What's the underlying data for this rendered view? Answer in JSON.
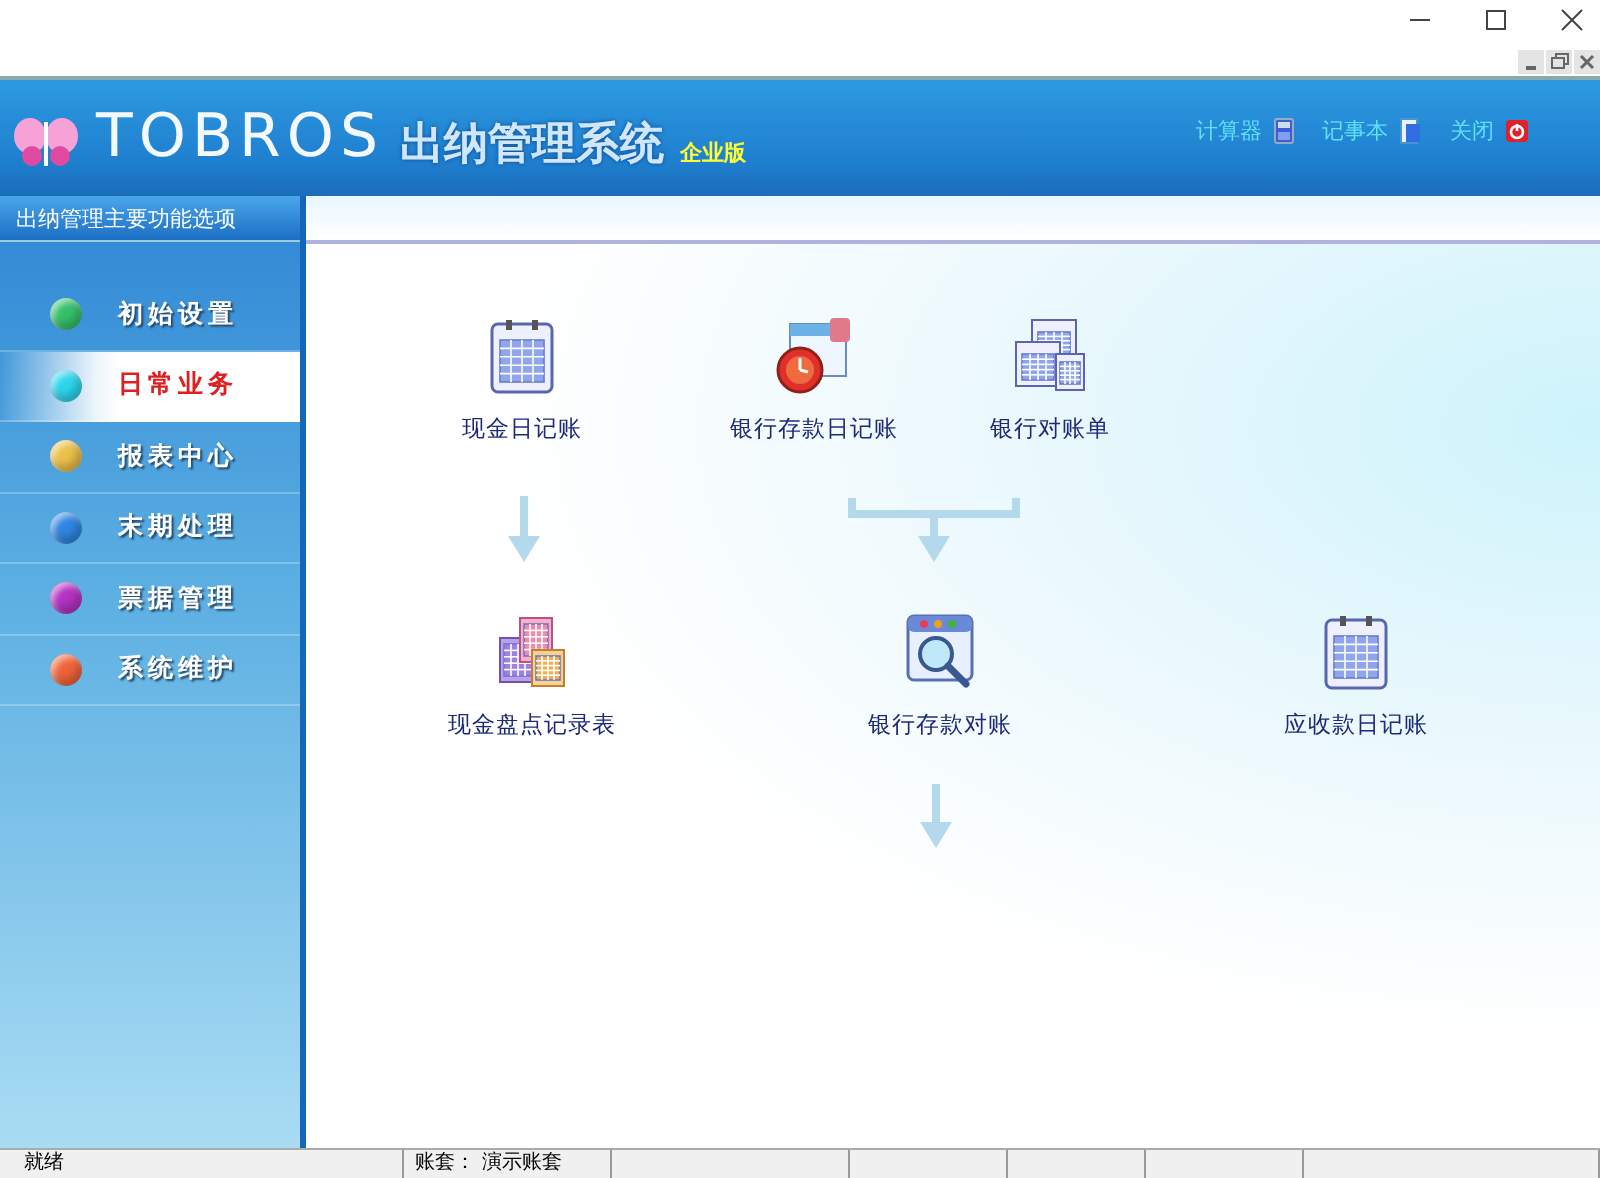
{
  "header": {
    "logo": "TOBROS",
    "title": "出纳管理系统",
    "edition": "企业版",
    "tools": [
      {
        "label": "计算器",
        "kind": "calculator"
      },
      {
        "label": "记事本",
        "kind": "notepad"
      },
      {
        "label": "关闭",
        "kind": "power"
      }
    ]
  },
  "sidebar": {
    "title": "出纳管理主要功能选项",
    "items": [
      {
        "label": "初始设置",
        "color": "#36c06a",
        "selected": false
      },
      {
        "label": "日常业务",
        "color": "#2cd6ee",
        "selected": true
      },
      {
        "label": "报表中心",
        "color": "#ecc048",
        "selected": false
      },
      {
        "label": "末期处理",
        "color": "#2f86e2",
        "selected": false
      },
      {
        "label": "票据管理",
        "color": "#b432c4",
        "selected": false
      },
      {
        "label": "系统维护",
        "color": "#f0643a",
        "selected": false
      }
    ]
  },
  "flow": {
    "nodes": [
      {
        "label": "现金日记账",
        "kind": "ledger"
      },
      {
        "label": "银行存款日记账",
        "kind": "clock"
      },
      {
        "label": "银行对账单",
        "kind": "calendars"
      },
      {
        "label": "现金盘点记录表",
        "kind": "sheets"
      },
      {
        "label": "银行存款对账",
        "kind": "search"
      },
      {
        "label": "应收款日记账",
        "kind": "ledger"
      }
    ]
  },
  "status_bar": [
    "就绪",
    "账套： 演示账套"
  ]
}
